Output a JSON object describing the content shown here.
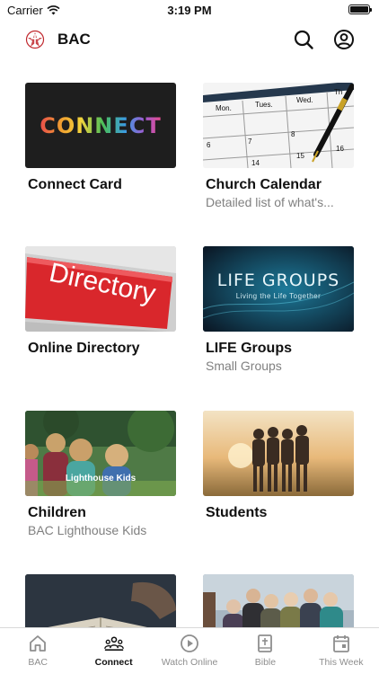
{
  "status": {
    "carrier": "Carrier",
    "time": "3:19 PM"
  },
  "header": {
    "title": "BAC",
    "logo_icon": "bac-logo-icon",
    "search_icon": "search-icon",
    "profile_icon": "profile-icon"
  },
  "cards": [
    {
      "title": "Connect Card",
      "subtitle": "",
      "thumb_text": "CONNECT"
    },
    {
      "title": "Church Calendar",
      "subtitle": "Detailed list of what's...",
      "thumb_text": ""
    },
    {
      "title": "Online Directory",
      "subtitle": "",
      "thumb_text": "Directory"
    },
    {
      "title": "LIFE Groups",
      "subtitle": "Small Groups",
      "thumb_text": "LIFE GROUPS",
      "thumb_subtext": "Living the Life Together"
    },
    {
      "title": "Children",
      "subtitle": "BAC Lighthouse Kids",
      "thumb_text": "Lighthouse Kids"
    },
    {
      "title": "Students",
      "subtitle": "",
      "thumb_text": ""
    },
    {
      "title": "",
      "subtitle": "",
      "thumb_text": ""
    },
    {
      "title": "",
      "subtitle": "",
      "thumb_text": ""
    }
  ],
  "calendar": {
    "days": [
      "Mon.",
      "Tues.",
      "Wed.",
      "Th"
    ],
    "dates": [
      "1",
      "6",
      "7",
      "8",
      "15",
      "16",
      "14"
    ]
  },
  "tabs": [
    {
      "label": "BAC",
      "icon": "home-icon",
      "active": false
    },
    {
      "label": "Connect",
      "icon": "people-icon",
      "active": true
    },
    {
      "label": "Watch Online",
      "icon": "play-icon",
      "active": false
    },
    {
      "label": "Bible",
      "icon": "bible-icon",
      "active": false
    },
    {
      "label": "This Week",
      "icon": "calendar-icon",
      "active": false
    }
  ]
}
